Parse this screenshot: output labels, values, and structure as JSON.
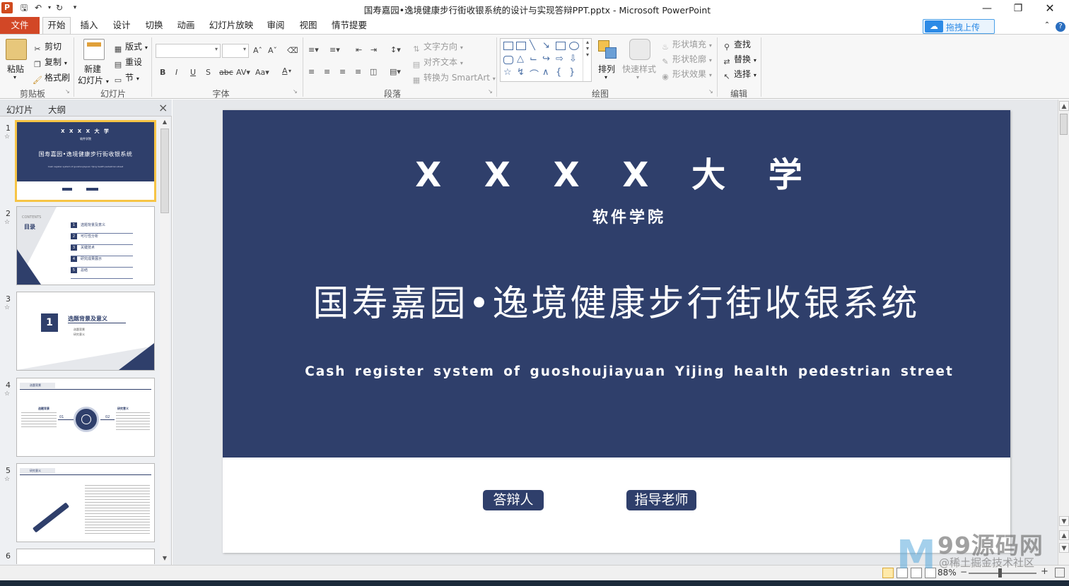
{
  "window": {
    "title": "国寿嘉园•逸境健康步行街收银系统的设计与实现答辩PPT.pptx - Microsoft PowerPoint",
    "upload_label": "拖拽上传"
  },
  "ribbon_tabs": [
    "文件",
    "开始",
    "插入",
    "设计",
    "切换",
    "动画",
    "幻灯片放映",
    "审阅",
    "视图",
    "情节提要"
  ],
  "ribbon": {
    "clipboard": {
      "paste": "粘贴",
      "cut": "剪切",
      "copy": "复制",
      "format_painter": "格式刷",
      "group": "剪贴板"
    },
    "slides": {
      "new_slide": "新建\n幻灯片",
      "new_slide_l1": "新建",
      "new_slide_l2": "幻灯片",
      "layout": "版式",
      "reset": "重设",
      "section": "节",
      "group": "幻灯片"
    },
    "font": {
      "group": "字体"
    },
    "paragraph": {
      "text_direction": "文字方向",
      "align_text": "对齐文本",
      "convert_smartart": "转换为 SmartArt",
      "group": "段落"
    },
    "drawing": {
      "arrange": "排列",
      "quick_styles": "快速样式",
      "shape_fill": "形状填充",
      "shape_outline": "形状轮廓",
      "shape_effects": "形状效果",
      "group": "绘图"
    },
    "editing": {
      "find": "查找",
      "replace": "替换",
      "select": "选择",
      "group": "编辑"
    }
  },
  "pane": {
    "tab_slides": "幻灯片",
    "tab_outline": "大纲",
    "close": "×"
  },
  "thumbnails": [
    {
      "num": "1",
      "univ": "X X X X 大 学",
      "college": "软件学院",
      "title": "国寿嘉园•逸境健康步行街收银系统",
      "sub": "Cash register system of guoshoujiayuan Yijing health pedestrian street"
    },
    {
      "num": "2",
      "contents": "CONTENTS",
      "heading": "目录",
      "items": [
        "选题背景及意义",
        "可行性分析",
        "关键技术",
        "研究成果展示",
        "总结"
      ]
    },
    {
      "num": "3",
      "badge": "1",
      "heading": "选题背景及意义",
      "lines": [
        "选题背景",
        "研究意义"
      ]
    },
    {
      "num": "4",
      "heading": "选题背景",
      "left": "选题背景",
      "right": "研究意义",
      "n1": "01",
      "n2": "02"
    },
    {
      "num": "5",
      "heading": "研究意义"
    },
    {
      "num": "6"
    }
  ],
  "slide": {
    "university": "X X X X 大 学",
    "college": "软件学院",
    "title": "国寿嘉园•逸境健康步行街收银系统",
    "subtitle": "Cash register system of guoshoujiayuan Yijing health pedestrian street",
    "defender_label": "答辩人",
    "advisor_label": "指导老师",
    "colors": {
      "band": "#2f3f6b",
      "text": "#ffffff"
    }
  },
  "status": {
    "zoom": "88%"
  },
  "watermark": {
    "logo": "M",
    "text": "99源码网",
    "sub": "@稀土掘金技术社区"
  }
}
